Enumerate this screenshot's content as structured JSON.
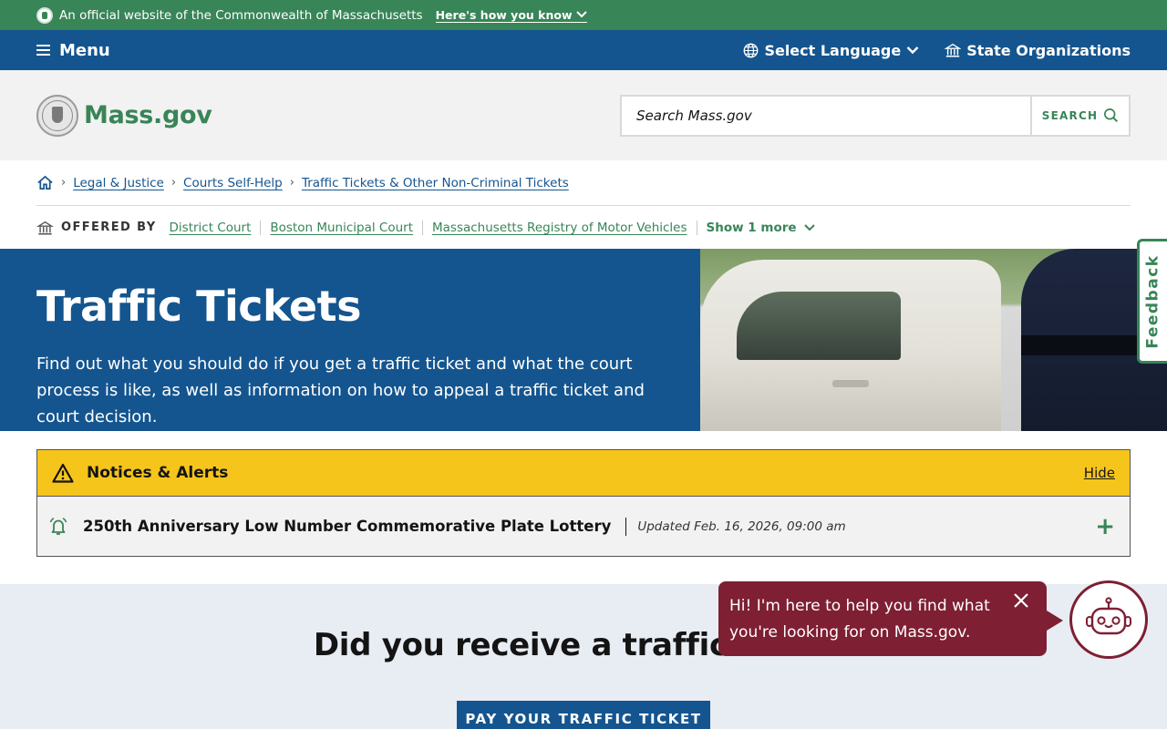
{
  "topbar": {
    "official_text": "An official website of the Commonwealth of Massachusetts",
    "how_link": "Here's how you know"
  },
  "nav": {
    "menu_label": "Menu",
    "language_label": "Select Language",
    "orgs_label": "State Organizations"
  },
  "header": {
    "logo_text": "Mass.gov",
    "search_placeholder": "Search Mass.gov",
    "search_button": "SEARCH"
  },
  "breadcrumbs": [
    "Legal & Justice",
    "Courts Self-Help",
    "Traffic Tickets & Other Non-Criminal Tickets"
  ],
  "offered_by": {
    "label": "OFFERED BY",
    "orgs": [
      "District Court",
      "Boston Municipal Court",
      "Massachusetts Registry of Motor Vehicles"
    ],
    "more": "Show 1 more"
  },
  "hero": {
    "title": "Traffic Tickets",
    "description": "Find out what you should do if you get a traffic ticket and what the court process is like, as well as information on how to appeal a traffic ticket and court decision."
  },
  "alerts": {
    "title": "Notices & Alerts",
    "hide": "Hide",
    "items": [
      {
        "title": "250th Anniversary Low Number Commemorative Plate Lottery",
        "updated": "Updated Feb. 16, 2026, 09:00 am"
      }
    ]
  },
  "section": {
    "heading": "Did you receive a traffic ticket?",
    "pay_button": "PAY YOUR TRAFFIC TICKET"
  },
  "feedback": {
    "label": "Feedback"
  },
  "chat": {
    "message": "Hi! I'm here to help you find what you're looking for on Mass.gov."
  },
  "colors": {
    "green": "#388557",
    "blue": "#14558f",
    "alert_yellow": "#f6c51b",
    "chat_maroon": "#7e1f33"
  }
}
